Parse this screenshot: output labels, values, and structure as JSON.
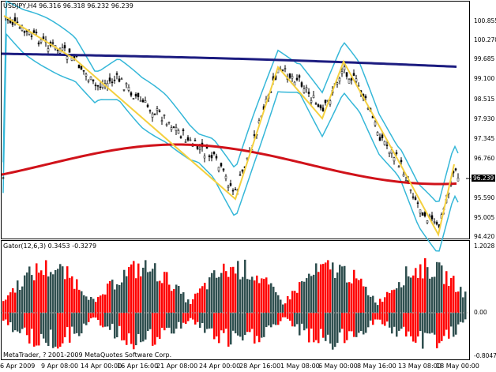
{
  "main_chart": {
    "title": "USDJPY,H4  96.316 96.318 96.232 96.239",
    "last_price": "96.239",
    "price_labels": [
      "100.855",
      "100.270",
      "99.685",
      "99.100",
      "98.515",
      "97.930",
      "97.345",
      "96.760",
      "96.175",
      "95.590",
      "95.005",
      "94.420"
    ],
    "colors": {
      "background": "#ffffff",
      "bbands": "#35b7d8",
      "ma_long": "#1c1c80",
      "ma_mid": "#d0121a",
      "zigzag": "#f4d03f",
      "candles": "#000000"
    }
  },
  "indicator": {
    "title": "Gator(12,6,3) 0.3453 -0.3279",
    "scale_labels": [
      "1.2028",
      "0.00",
      "-0.8047"
    ],
    "colors": {
      "up": "#ff0000",
      "down": "#2f4f4f"
    }
  },
  "footer": {
    "copyright": "MetaTrader, ? 2001-2009 MetaQuotes Software Corp."
  },
  "dates": [
    "6 Apr 2009",
    "9 Apr 08:00",
    "14 Apr 00:00",
    "16 Apr 16:00",
    "21 Apr 08:00",
    "24 Apr 00:00",
    "28 Apr 16:00",
    "1 May 08:00",
    "6 May 00:00",
    "8 May 16:00",
    "13 May 08:00",
    "18 May 00:00"
  ]
}
